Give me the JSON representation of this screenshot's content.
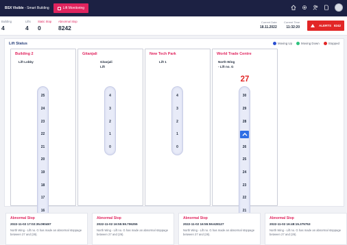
{
  "topbar": {
    "brand_bold": "BSX Visible",
    "brand_rest": " - Smart Building",
    "app_tab": "Lift Monitoring",
    "icons": [
      "home-icon",
      "gear-icon",
      "users-icon",
      "document-icon",
      "user-avatar"
    ]
  },
  "summary": {
    "building_label": "Building",
    "building_value": "4",
    "lifts_label": "Lifts",
    "lifts_value": "4",
    "static_label": "Static Stop",
    "static_value": "0",
    "abnormal_label": "Abnormal Stop",
    "abnormal_value": "8242",
    "date_label": "Current Date",
    "date_value": "18.11.2022",
    "time_label": "Current Time",
    "time_value": "11:32:20",
    "alerts_label": "ALERTS",
    "alerts_count": "8242"
  },
  "main": {
    "title": "Lift Status",
    "legend": [
      {
        "label": "Moving Up",
        "color": "#2b4fd1"
      },
      {
        "label": "Moving Down",
        "color": "#2ec27e"
      },
      {
        "label": "Stopped",
        "color": "#e22626"
      }
    ]
  },
  "buildings": [
    {
      "name": "Building 2",
      "lift": [
        "Lift Lobby"
      ],
      "floors": [
        "25",
        "24",
        "23",
        "22",
        "21",
        "20",
        "19",
        "18",
        "17",
        "16"
      ],
      "active_floor": null,
      "current": ""
    },
    {
      "name": "Gitanjali",
      "lift": [
        "Gitanjali",
        "Lift"
      ],
      "floors": [
        "4",
        "3",
        "2",
        "1",
        "0"
      ],
      "active_floor": null,
      "current": ""
    },
    {
      "name": "New Tech Park",
      "lift": [
        "Lift 1"
      ],
      "floors": [
        "4",
        "3",
        "2",
        "1",
        "0"
      ],
      "active_floor": null,
      "current": ""
    },
    {
      "name": "World Trade Centre",
      "lift": [
        "North Wing",
        "- Lift no. G"
      ],
      "floors": [
        "30",
        "29",
        "28",
        "27",
        "26",
        "25",
        "24",
        "23",
        "22",
        "21"
      ],
      "active_floor": "27",
      "current": "27"
    }
  ],
  "alerts": [
    {
      "title": "Abnormal Stop",
      "datetime": "2022-11-02 17:02:35.090497",
      "message": "North Wing - Lift no. G has made an abnormal stoppage between 27 and (26)."
    },
    {
      "title": "Abnormal Stop",
      "datetime": "2022-11-02 16:55:59.706255",
      "message": "North Wing - Lift no. G has made an abnormal stoppage between 27 and (26)."
    },
    {
      "title": "Abnormal Stop",
      "datetime": "2022-11-02 16:55:59.628127",
      "message": "North Wing - Lift no. G has made an abnormal stoppage between 27 and (26)."
    },
    {
      "title": "Abnormal Stop",
      "datetime": "2022-11-02 16:48:15.375753",
      "message": "North Wing - Lift no. G has made an abnormal stoppage between 27 and (26)."
    }
  ]
}
